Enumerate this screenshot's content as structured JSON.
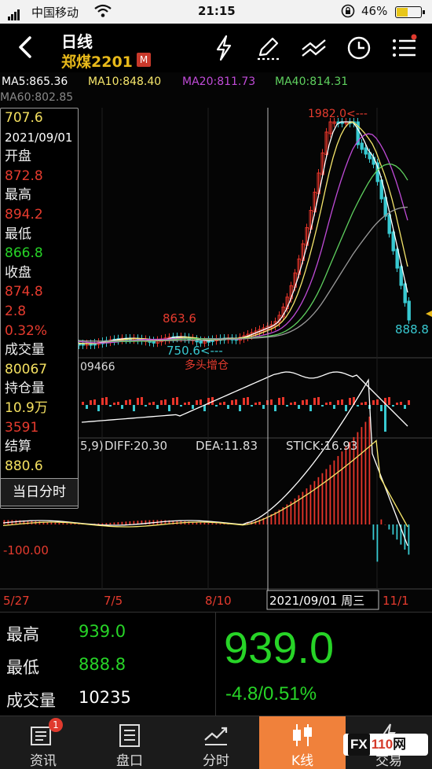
{
  "status": {
    "carrier": "中国移动",
    "time": "21:15",
    "battery_pct": "46%",
    "battery_level": 0.46
  },
  "header": {
    "title": "日线",
    "contract": "郑煤2201",
    "badge": "M",
    "icons": [
      "lightning-icon",
      "pen-icon",
      "drawing-lines-icon",
      "clock-icon",
      "menu-icon"
    ]
  },
  "ma": {
    "ma5": "MA5:865.36",
    "ma10": "MA10:848.40",
    "ma20": "MA20:811.73",
    "ma40": "MA40:814.31",
    "ma60": "MA60:802.85",
    "colors": {
      "ma5": "#ffffff",
      "ma10": "#f6e66b",
      "ma20": "#c04bd8",
      "ma40": "#5fd15f",
      "ma60": "#9a9a9a"
    }
  },
  "infobox": {
    "price": "707.6",
    "date": "2021/09/01",
    "open_label": "开盘",
    "open": "872.8",
    "high_label": "最高",
    "high": "894.2",
    "low_label": "最低",
    "low": "866.8",
    "close_label": "收盘",
    "close": "874.8",
    "change": "2.8",
    "change_pct": "0.32%",
    "volume_label": "成交量",
    "volume": "80067",
    "oi_label": "持仓量",
    "oi": "10.9万",
    "oi_change": "3591",
    "settle_label": "结算",
    "settle": "880.6",
    "intraday_button": "当日分时"
  },
  "chart_annotations": {
    "max_label": "1982.0<---",
    "mid_high": "863.6",
    "low_label": "750.6<---",
    "right_price": "888.8",
    "volume_readout": "09466",
    "signal": "多头增仓",
    "macd_params": "5,9)",
    "diff": "DIFF:20.30",
    "dea": "DEA:11.83",
    "stick": "STICK:16.93",
    "macd_tick": "-100.00",
    "dates": [
      "5/27",
      "7/5",
      "8/10",
      "11/1"
    ],
    "cursor_date": "2021/09/01 周三"
  },
  "quote": {
    "high_label": "最高",
    "high": "939.0",
    "low_label": "最低",
    "low": "888.8",
    "volume_label": "成交量",
    "volume": "10235",
    "last": "939.0",
    "change": "-4.8/0.51%"
  },
  "tabs": [
    {
      "label": "资讯",
      "badge": "1"
    },
    {
      "label": "盘口"
    },
    {
      "label": "分时"
    },
    {
      "label": "K线",
      "active": true
    },
    {
      "label": "交易"
    }
  ],
  "watermark": {
    "prefix": "FX",
    "number": "110",
    "suffix": "网"
  }
}
